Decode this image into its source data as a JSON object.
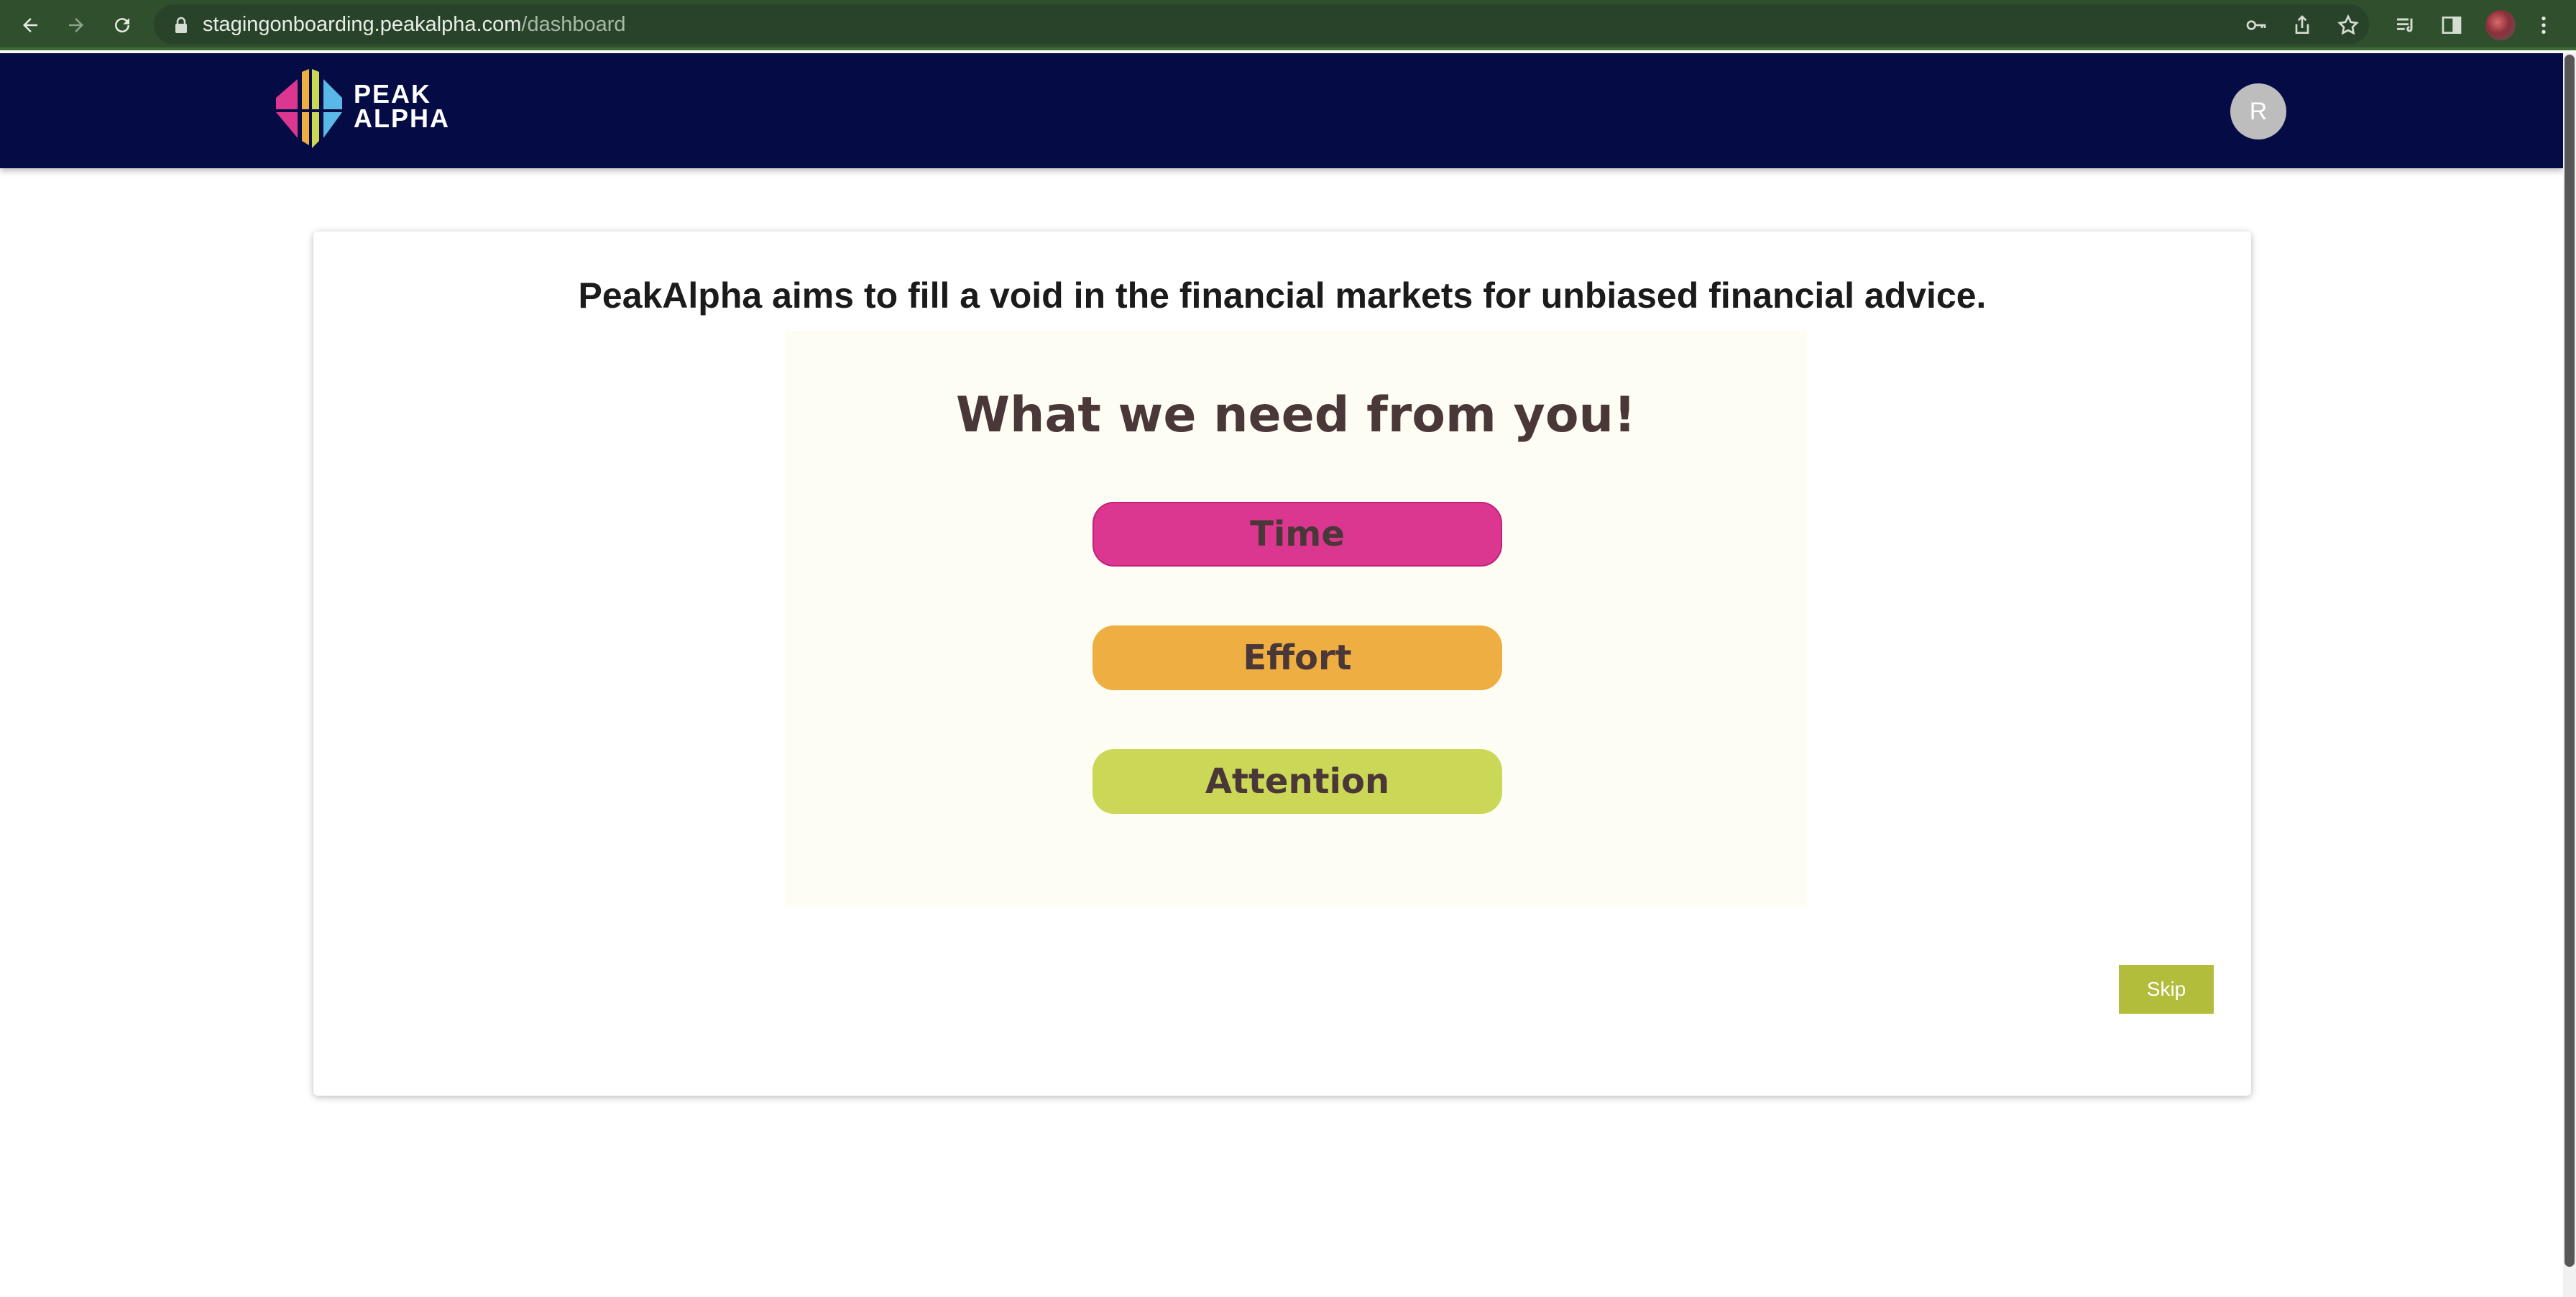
{
  "browser": {
    "url_host": "stagingonboarding.peakalpha.com",
    "url_path": "/dashboard",
    "icons": [
      "back-arrow-icon",
      "forward-arrow-icon",
      "reload-icon",
      "lock-icon",
      "key-icon",
      "share-icon",
      "star-icon",
      "reading-list-icon",
      "side-panel-icon",
      "kebab-menu-icon"
    ]
  },
  "header": {
    "logo_line1": "PEAK",
    "logo_line2": "ALPHA",
    "avatar_initial": "R",
    "colors": {
      "background": "#050c45",
      "avatar": "#bdbdbd"
    }
  },
  "card": {
    "headline": "PeakAlpha aims to fill a void in the financial markets for unbiased financial advice.",
    "panel_title": "What we need from you!",
    "pills": [
      {
        "label": "Time",
        "color": "#dc3790"
      },
      {
        "label": "Effort",
        "color": "#efae42"
      },
      {
        "label": "Attention",
        "color": "#cbd756"
      }
    ],
    "skip_label": "Skip",
    "skip_color": "#b2bd3c"
  }
}
